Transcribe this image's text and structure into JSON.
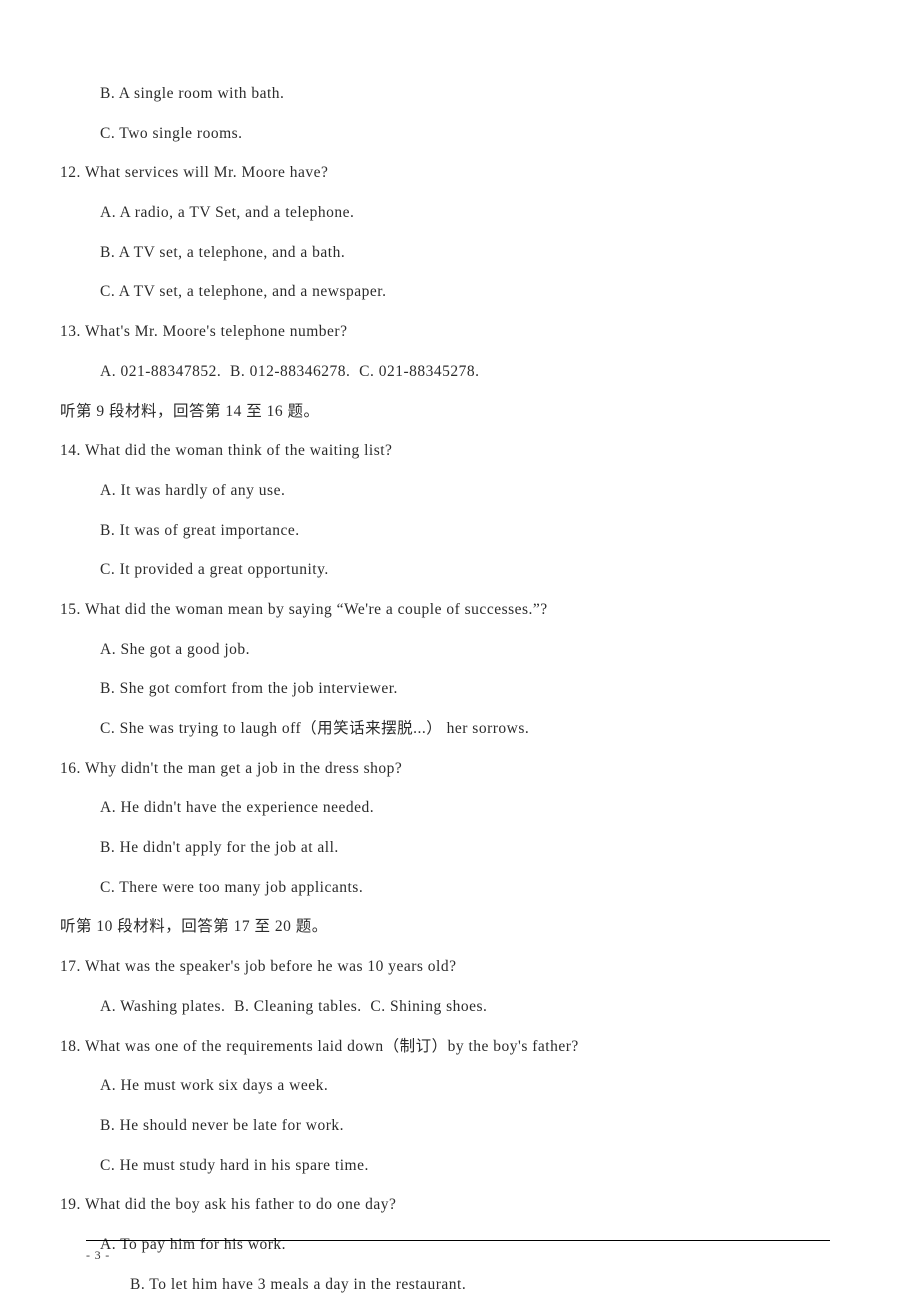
{
  "lines": [
    {
      "indent": 1,
      "text": "B. A single room with bath."
    },
    {
      "indent": 1,
      "text": "C. Two single rooms."
    },
    {
      "indent": 0,
      "text": "12. What services will Mr. Moore have?"
    },
    {
      "indent": 1,
      "text": "A. A radio, a TV Set, and a telephone."
    },
    {
      "indent": 1,
      "text": "B. A TV set, a telephone, and a bath."
    },
    {
      "indent": 1,
      "text": "C. A TV set, a telephone, and a newspaper."
    },
    {
      "indent": 0,
      "text": "13. What's Mr. Moore's telephone number?"
    },
    {
      "indent": 1,
      "text": "A. 021-88347852.  B. 012-88346278.  C. 021-88345278."
    },
    {
      "indent": 0,
      "text": "听第 9 段材料，回答第 14 至 16 题。"
    },
    {
      "indent": 0,
      "text": "14. What did the woman think of the waiting list?"
    },
    {
      "indent": 1,
      "text": "A. It was hardly of any use."
    },
    {
      "indent": 1,
      "text": "B. It was of great importance."
    },
    {
      "indent": 1,
      "text": "C. It provided a great opportunity."
    },
    {
      "indent": 0,
      "text": "15. What did the woman mean by saying “We're a couple of successes.”?"
    },
    {
      "indent": 1,
      "text": "A. She got a good job."
    },
    {
      "indent": 1,
      "text": "B. She got comfort from the job interviewer."
    },
    {
      "indent": 1,
      "text": "C. She was trying to laugh off（用笑话来摆脱...） her sorrows."
    },
    {
      "indent": 0,
      "text": "16. Why didn't the man get a job in the dress shop?"
    },
    {
      "indent": 1,
      "text": "A. He didn't have the experience needed."
    },
    {
      "indent": 1,
      "text": "B. He didn't apply for the job at all."
    },
    {
      "indent": 1,
      "text": "C. There were too many job applicants."
    },
    {
      "indent": 0,
      "text": "听第 10 段材料，回答第 17 至 20 题。"
    },
    {
      "indent": 0,
      "text": "17. What was the speaker's job before he was 10 years old?"
    },
    {
      "indent": 1,
      "text": "A. Washing plates.  B. Cleaning tables.  C. Shining shoes."
    },
    {
      "indent": 0,
      "text": "18. What was one of the requirements laid down（制订）by the boy's father?"
    },
    {
      "indent": 1,
      "text": "A. He must work six days a week."
    },
    {
      "indent": 1,
      "text": "B. He should never be late for work."
    },
    {
      "indent": 1,
      "text": "C. He must study hard in his spare time."
    },
    {
      "indent": 0,
      "text": "19. What did the boy ask his father to do one day?"
    },
    {
      "indent": 1,
      "text": "A. To pay him for his work."
    },
    {
      "indent": 2,
      "text": "B. To let him have 3 meals a day in the restaurant."
    }
  ],
  "pageNumber": "- 3 -"
}
